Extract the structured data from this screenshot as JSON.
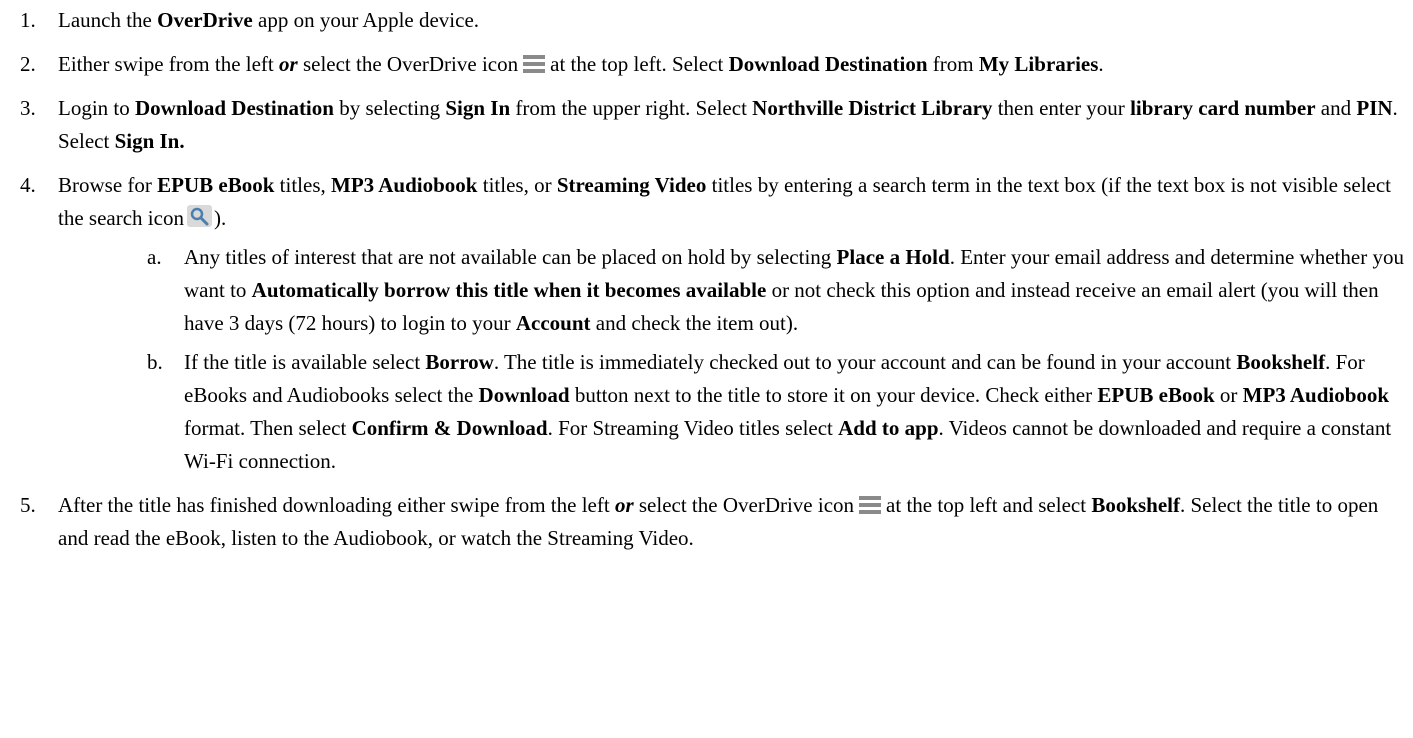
{
  "steps": [
    {
      "num": "1.",
      "parts": [
        "Launch the ",
        "OverDrive",
        " app on your Apple device."
      ]
    },
    {
      "num": "2.",
      "parts": [
        "Either swipe from the left ",
        "or",
        " select the OverDrive icon",
        "at the top left. Select ",
        "Download Destination",
        " from ",
        "My Libraries",
        "."
      ]
    },
    {
      "num": "3.",
      "parts": [
        "Login to ",
        "Download Destination",
        " by selecting ",
        "Sign In",
        " from the upper right. Select ",
        "Northville District Library",
        " then enter your ",
        "library card number",
        " and ",
        "PIN",
        ". Select ",
        "Sign In."
      ]
    },
    {
      "num": "4.",
      "parts": [
        "Browse for ",
        "EPUB eBook",
        " titles, ",
        "MP3 Audiobook",
        " titles, or ",
        "Streaming Video",
        " titles by entering a search term in the text box (if the text box is not visible select the search icon",
        ")."
      ],
      "substeps": [
        {
          "num": "a.",
          "parts": [
            "Any titles of interest that are not available can be placed on hold by selecting ",
            "Place a Hold",
            ". Enter your email address and determine whether you want to ",
            "Automatically borrow this title when it becomes available",
            " or not check this option and instead receive an email alert (you will then have 3 days (72 hours) to login to your ",
            "Account",
            " and check the item out)."
          ]
        },
        {
          "num": "b.",
          "parts": [
            "If the title is available select ",
            "Borrow",
            ". The title is immediately checked out to your account and can be found in your account ",
            "Bookshelf",
            ". For eBooks and Audiobooks select the ",
            "Download",
            " button next to the title to store it on your device. Check either ",
            "EPUB eBook",
            " or ",
            "MP3 Audiobook",
            " format. Then select ",
            "Confirm & Download",
            ". For Streaming Video titles select ",
            "Add to app",
            ". Videos cannot be downloaded and require a constant Wi-Fi connection."
          ]
        }
      ]
    },
    {
      "num": "5.",
      "parts": [
        "After the title has finished downloading either swipe from the left ",
        "or",
        " select the OverDrive icon",
        "at the top left and select ",
        "Bookshelf",
        ". Select the title to open and read the eBook, listen to the Audiobook, or watch the Streaming Video."
      ]
    }
  ],
  "icons": {
    "menu": "hamburger-menu-icon",
    "search": "magnifier-search-icon",
    "menu_color": "#8a8a8a",
    "search_bg": "#d9d9d9",
    "search_color": "#4a7fb0"
  }
}
